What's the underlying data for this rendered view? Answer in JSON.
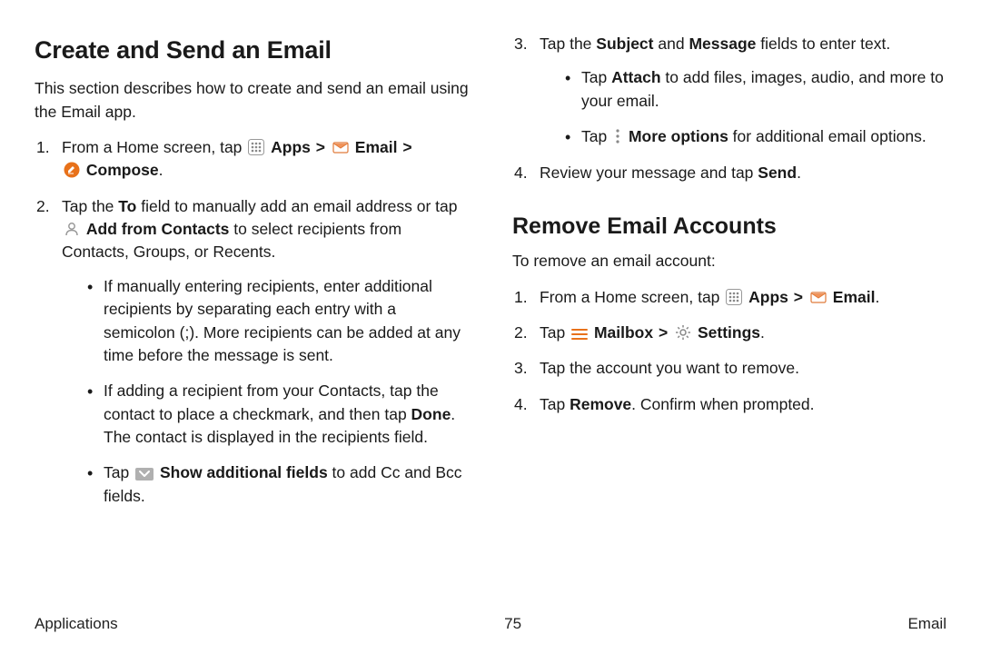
{
  "left": {
    "heading": "Create and Send an Email",
    "intro": "This section describes how to create and send an email using the Email app.",
    "step1": {
      "a": "From a Home screen, tap ",
      "apps": "Apps",
      "email": "Email",
      "compose": "Compose",
      "end": "."
    },
    "step2": {
      "a": "Tap the ",
      "to": "To",
      "b": " field to manually add an email address or tap ",
      "add": "Add from Contacts",
      "c": " to select recipients from Contacts, Groups, or Recents."
    },
    "sub1": "If manually entering recipients, enter additional recipients by separating each entry with a semicolon (;). More recipients can be added at any time before the message is sent.",
    "sub2": {
      "a": "If adding a recipient from your Contacts, tap the contact to place a checkmark, and then tap ",
      "done": "Done",
      "b": ". The contact is displayed in the recipients field."
    },
    "sub3": {
      "a": "Tap ",
      "show": "Show additional fields",
      "b": " to add Cc and Bcc fields."
    }
  },
  "right": {
    "step3": {
      "a": "Tap the ",
      "subject": "Subject",
      "and": " and ",
      "message": "Message",
      "b": " fields to enter text."
    },
    "sub1": {
      "a": "Tap ",
      "attach": "Attach",
      "b": " to add files, images, audio, and more to your email."
    },
    "sub2": {
      "a": "Tap ",
      "more": "More options",
      "b": " for additional email options."
    },
    "step4": {
      "a": "Review your message and tap ",
      "send": "Send",
      "b": "."
    },
    "heading2": "Remove Email Accounts",
    "intro2": "To remove an email account:",
    "r1": {
      "a": "From a Home screen, tap ",
      "apps": "Apps",
      "email": "Email",
      "end": "."
    },
    "r2": {
      "a": "Tap ",
      "mailbox": "Mailbox",
      "settings": "Settings",
      "end": "."
    },
    "r3": "Tap the account you want to remove.",
    "r4": {
      "a": "Tap ",
      "remove": "Remove",
      "b": ". Confirm when prompted."
    }
  },
  "footer": {
    "left": "Applications",
    "center": "75",
    "right": "Email"
  },
  "sep": ">"
}
